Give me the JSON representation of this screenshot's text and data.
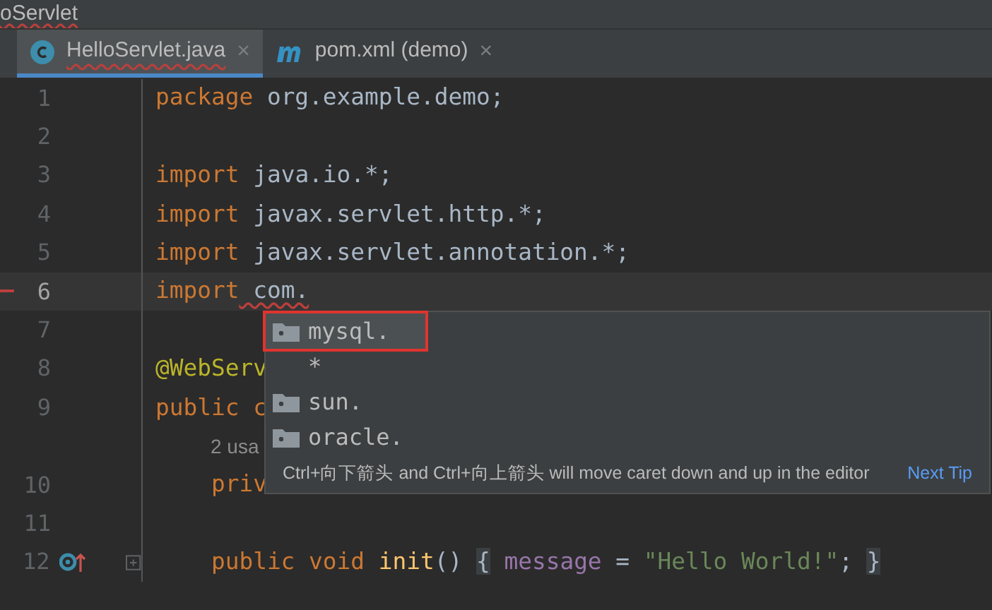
{
  "breadcrumb": {
    "text": "oServlet",
    "error": true
  },
  "tabs": [
    {
      "label": "HelloServlet.java",
      "kind": "java",
      "selected": true,
      "error": true,
      "close": "×"
    },
    {
      "label": "pom.xml (demo)",
      "kind": "maven",
      "selected": false,
      "error": false,
      "close": "×"
    }
  ],
  "editor": {
    "lines": [
      {
        "kind": "code",
        "number": "1",
        "current": false,
        "tokens": [
          {
            "kind": "keyword",
            "text": "package"
          },
          {
            "kind": "plain",
            "text": " org.example.demo;"
          }
        ]
      },
      {
        "kind": "code",
        "number": "2",
        "current": false
      },
      {
        "kind": "code",
        "number": "3",
        "current": false,
        "tokens": [
          {
            "kind": "keyword",
            "text": "import"
          },
          {
            "kind": "plain",
            "text": " java.io.*;"
          }
        ]
      },
      {
        "kind": "code",
        "number": "4",
        "current": false,
        "tokens": [
          {
            "kind": "keyword",
            "text": "import"
          },
          {
            "kind": "plain",
            "text": " javax.servlet.http.*;"
          }
        ]
      },
      {
        "kind": "code",
        "number": "5",
        "current": false,
        "tokens": [
          {
            "kind": "keyword",
            "text": "import"
          },
          {
            "kind": "plain",
            "text": " javax.servlet.annotation.*;"
          }
        ]
      },
      {
        "kind": "code",
        "number": "6",
        "current": true,
        "error_marker": true,
        "tokens": [
          {
            "kind": "keyword",
            "text": "import"
          },
          {
            "kind": "plain",
            "text": " com.",
            "squiggle": true
          }
        ]
      },
      {
        "kind": "code",
        "number": "7",
        "current": false
      },
      {
        "kind": "code",
        "number": "8",
        "current": false,
        "tokens": [
          {
            "kind": "annotation",
            "text": "@WebServ"
          }
        ]
      },
      {
        "kind": "code",
        "number": "9",
        "current": false,
        "tokens": [
          {
            "kind": "keyword",
            "text": "public c"
          }
        ]
      },
      {
        "kind": "hint",
        "text": "2 usa"
      },
      {
        "kind": "code",
        "number": "10",
        "current": false,
        "tokens": [
          {
            "kind": "keyword",
            "text": "    priv"
          }
        ]
      },
      {
        "kind": "code",
        "number": "11",
        "current": false
      },
      {
        "kind": "code",
        "number": "12",
        "current": false,
        "overrides": true,
        "foldable": true,
        "tokens": [
          {
            "kind": "keyword",
            "text": "    public void "
          },
          {
            "kind": "method",
            "text": "init"
          },
          {
            "kind": "plain",
            "text": "() "
          },
          {
            "kind": "brace",
            "text": "{"
          },
          {
            "kind": "field",
            "text": " message"
          },
          {
            "kind": "plain",
            "text": " = "
          },
          {
            "kind": "string",
            "text": "\"Hello World!\""
          },
          {
            "kind": "plain",
            "text": "; "
          },
          {
            "kind": "brace",
            "text": "}"
          }
        ]
      }
    ]
  },
  "completion": {
    "items": [
      {
        "label": "mysql.",
        "kind": "package",
        "selected": true,
        "outlined": true
      },
      {
        "label": "*",
        "kind": "wildcard",
        "selected": false,
        "outlined": false
      },
      {
        "label": "sun.",
        "kind": "package",
        "selected": false,
        "outlined": false
      },
      {
        "label": "oracle.",
        "kind": "package",
        "selected": false,
        "outlined": false
      }
    ],
    "tip": "Ctrl+向下箭头 and Ctrl+向上箭头 will move caret down and up in the editor",
    "next_tip": "Next Tip"
  }
}
